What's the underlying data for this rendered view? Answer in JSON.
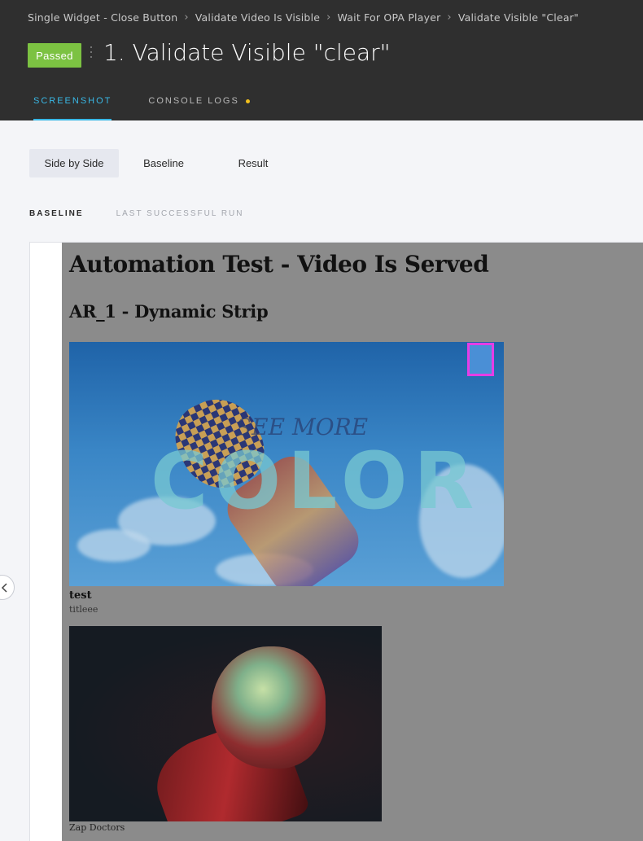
{
  "breadcrumb": {
    "items": [
      "Single Widget - Close Button",
      "Validate Video Is Visible",
      "Wait For OPA Player",
      "Validate Visible \"Clear\""
    ],
    "separator": "›"
  },
  "status": {
    "label": "Passed",
    "color": "#7cc242"
  },
  "page_title": "1. Validate Visible \"clear\"",
  "tabs": [
    {
      "label": "SCREENSHOT",
      "active": true
    },
    {
      "label": "CONSOLE LOGS",
      "active": false,
      "indicator_color": "#f2c01d"
    }
  ],
  "view_toggle": {
    "options": [
      "Side by Side",
      "Baseline",
      "Result"
    ],
    "selected": "Side by Side"
  },
  "sections": {
    "baseline_label": "BASELINE",
    "last_run_label": "LAST SUCCESSFUL RUN"
  },
  "screenshot": {
    "heading": "Automation Test - Video Is Served",
    "subheading": "AR_1 - Dynamic Strip",
    "video1": {
      "overlay_text": "COLOR",
      "overlay_script": "SEE MORE"
    },
    "caption1_title": "test",
    "caption1_sub": "titleee",
    "caption2": "Zap Doctors"
  },
  "icons": {
    "breadcrumb_separator": "chevron-right-icon",
    "prev": "chevron-left-icon"
  },
  "colors": {
    "header_bg": "#2f2f2f",
    "accent": "#39b8e6",
    "highlight": "#e53de6"
  }
}
